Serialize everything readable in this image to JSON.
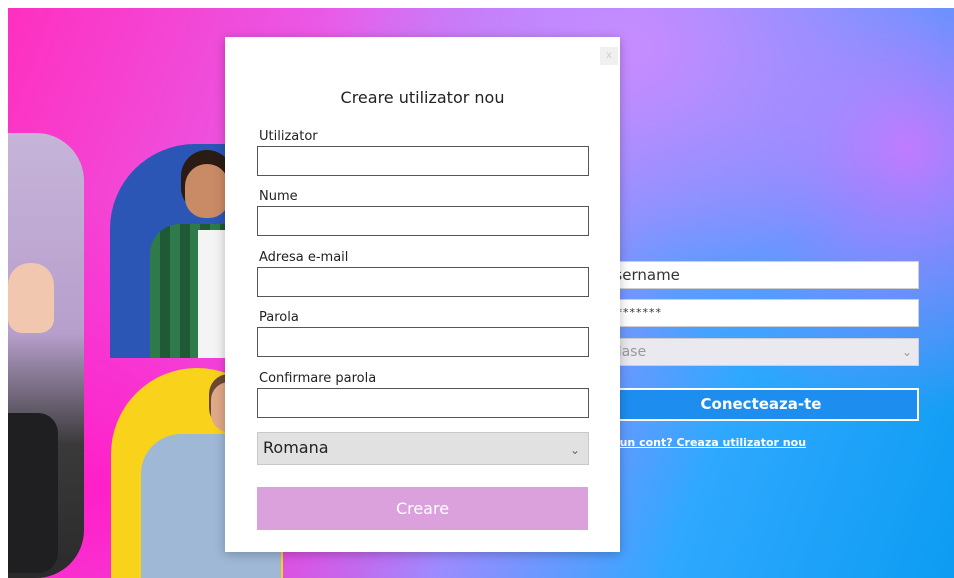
{
  "login": {
    "username_value": "Jsername",
    "password_value": "********",
    "class_select_value": "clase",
    "connect_label": "Conecteaza-te",
    "create_account_link": "i un cont? Creaza utilizator nou"
  },
  "modal": {
    "close_label": "x",
    "title": "Creare utilizator nou",
    "fields": [
      {
        "label": "Utilizator",
        "value": ""
      },
      {
        "label": "Nume",
        "value": ""
      },
      {
        "label": "Adresa e-mail",
        "value": ""
      },
      {
        "label": "Parola",
        "value": ""
      },
      {
        "label": "Confirmare parola",
        "value": ""
      }
    ],
    "language_value": "Romana",
    "submit_label": "Creare"
  },
  "colors": {
    "submit_bg": "#dba1dd",
    "connect_bg": "#1d8df0"
  },
  "icons": {
    "close": "close-icon",
    "dropdown": "chevron-down-icon"
  }
}
